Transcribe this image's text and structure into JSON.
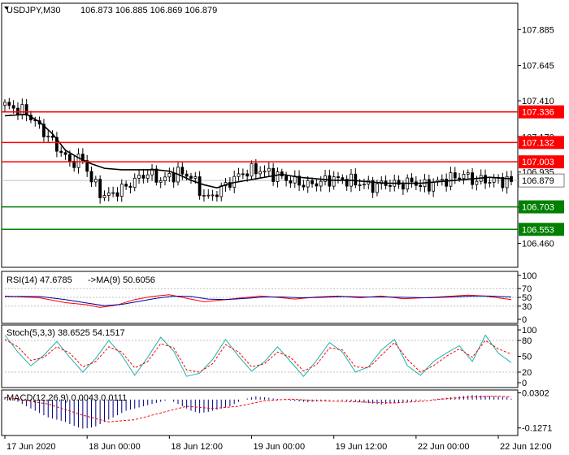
{
  "chart_data": [
    {
      "type": "candlestick",
      "header": {
        "symbol_tf": "USDJPY,M30",
        "ohlc": "106.873 106.885 106.869 106.879"
      },
      "ylim": [
        106.3,
        108.06
      ],
      "y_ticks": [
        "107.885",
        "107.645",
        "107.410",
        "107.170",
        "106.935",
        "106.700",
        "106.460"
      ],
      "last_price": {
        "value": 106.879,
        "label": "106.879"
      },
      "levels": [
        {
          "value": 107.336,
          "label": "107.336",
          "color": "#ff0000",
          "kind": "resistance"
        },
        {
          "value": 107.132,
          "label": "107.132",
          "color": "#ff0000",
          "kind": "resistance"
        },
        {
          "value": 107.003,
          "label": "107.003",
          "color": "#ff0000",
          "kind": "resistance"
        },
        {
          "value": 106.703,
          "label": "106.703",
          "color": "#008000",
          "kind": "support"
        },
        {
          "value": 106.553,
          "label": "106.553",
          "color": "#008000",
          "kind": "support"
        }
      ],
      "moving_average_color": "#000000",
      "close_path": [
        [
          0,
          107.38
        ],
        [
          5,
          107.33
        ],
        [
          10,
          107.17
        ],
        [
          15,
          107.0
        ],
        [
          18,
          107.02
        ],
        [
          20,
          106.88
        ],
        [
          23,
          106.77
        ],
        [
          27,
          106.82
        ],
        [
          30,
          106.88
        ],
        [
          33,
          106.93
        ],
        [
          36,
          106.88
        ],
        [
          40,
          106.93
        ],
        [
          43,
          106.91
        ],
        [
          45,
          106.81
        ],
        [
          47,
          106.76
        ],
        [
          49,
          106.8
        ],
        [
          52,
          106.87
        ],
        [
          55,
          106.93
        ],
        [
          58,
          106.95
        ],
        [
          61,
          106.93
        ],
        [
          64,
          106.9
        ],
        [
          67,
          106.87
        ],
        [
          70,
          106.85
        ],
        [
          73,
          106.87
        ],
        [
          76,
          106.89
        ],
        [
          79,
          106.88
        ],
        [
          82,
          106.86
        ],
        [
          85,
          106.84
        ],
        [
          88,
          106.86
        ],
        [
          91,
          106.85
        ],
        [
          94,
          106.87
        ],
        [
          97,
          106.84
        ],
        [
          100,
          106.87
        ],
        [
          103,
          106.89
        ],
        [
          106,
          106.92
        ],
        [
          108,
          106.88
        ],
        [
          111,
          106.88
        ],
        [
          114,
          106.88
        ],
        [
          117,
          106.87
        ]
      ],
      "ma_path": [
        [
          0,
          107.31
        ],
        [
          5,
          107.32
        ],
        [
          8,
          107.27
        ],
        [
          11,
          107.19
        ],
        [
          14,
          107.08
        ],
        [
          17,
          107.03
        ],
        [
          20,
          106.99
        ],
        [
          23,
          106.96
        ],
        [
          27,
          106.95
        ],
        [
          31,
          106.95
        ],
        [
          35,
          106.95
        ],
        [
          38,
          106.94
        ],
        [
          40,
          106.92
        ],
        [
          43,
          106.88
        ],
        [
          46,
          106.85
        ],
        [
          49,
          106.83
        ],
        [
          52,
          106.86
        ],
        [
          56,
          106.88
        ],
        [
          60,
          106.9
        ],
        [
          64,
          106.92
        ],
        [
          68,
          106.9
        ],
        [
          72,
          106.89
        ],
        [
          76,
          106.88
        ],
        [
          80,
          106.88
        ],
        [
          84,
          106.87
        ],
        [
          88,
          106.86
        ],
        [
          92,
          106.86
        ],
        [
          96,
          106.86
        ],
        [
          100,
          106.87
        ],
        [
          104,
          106.88
        ],
        [
          108,
          106.89
        ],
        [
          112,
          106.9
        ],
        [
          117,
          106.89
        ]
      ],
      "x_ticks": [
        {
          "i": 0,
          "label": "17 Jun 2020"
        },
        {
          "i": 19,
          "label": "18 Jun 00:00"
        },
        {
          "i": 38,
          "label": "18 Jun 12:00"
        },
        {
          "i": 57,
          "label": "19 Jun 00:00"
        },
        {
          "i": 76,
          "label": "19 Jun 12:00"
        },
        {
          "i": 95,
          "label": "22 Jun 00:00"
        },
        {
          "i": 114,
          "label": "22 Jun 12:00"
        }
      ]
    },
    {
      "type": "line",
      "title": "RSI(14) 47.6785",
      "title2": "->MA(9) 50.6056",
      "ylim": [
        0,
        100
      ],
      "y_ticks": [
        "100",
        "70",
        "50",
        "30",
        "0"
      ],
      "levels": [
        70,
        50,
        30
      ],
      "series": [
        {
          "color": "#ff0000",
          "points": [
            [
              0,
              53
            ],
            [
              8,
              49
            ],
            [
              14,
              38
            ],
            [
              19,
              33
            ],
            [
              22,
              27
            ],
            [
              26,
              33
            ],
            [
              30,
              45
            ],
            [
              34,
              52
            ],
            [
              38,
              56
            ],
            [
              42,
              48
            ],
            [
              46,
              40
            ],
            [
              50,
              44
            ],
            [
              55,
              49
            ],
            [
              59,
              53
            ],
            [
              63,
              50
            ],
            [
              67,
              46
            ],
            [
              72,
              51
            ],
            [
              77,
              53
            ],
            [
              82,
              49
            ],
            [
              87,
              53
            ],
            [
              92,
              47
            ],
            [
              97,
              49
            ],
            [
              102,
              52
            ],
            [
              107,
              55
            ],
            [
              111,
              53
            ],
            [
              117,
              45
            ]
          ]
        },
        {
          "color": "#0000a0",
          "points": [
            [
              0,
              52
            ],
            [
              8,
              52
            ],
            [
              14,
              45
            ],
            [
              19,
              37
            ],
            [
              23,
              31
            ],
            [
              27,
              34
            ],
            [
              31,
              41
            ],
            [
              35,
              48
            ],
            [
              39,
              53
            ],
            [
              43,
              52
            ],
            [
              47,
              46
            ],
            [
              51,
              45
            ],
            [
              56,
              48
            ],
            [
              60,
              51
            ],
            [
              64,
              51
            ],
            [
              68,
              49
            ],
            [
              73,
              50
            ],
            [
              78,
              52
            ],
            [
              83,
              51
            ],
            [
              88,
              51
            ],
            [
              93,
              50
            ],
            [
              98,
              49
            ],
            [
              103,
              51
            ],
            [
              108,
              53
            ],
            [
              112,
              53
            ],
            [
              117,
              51
            ]
          ]
        }
      ]
    },
    {
      "type": "line",
      "title": "Stoch(5,3,3) 38.6525 54.1517",
      "ylim": [
        0,
        100
      ],
      "y_ticks": [
        "100",
        "80",
        "50",
        "20",
        "0"
      ],
      "levels": [
        80,
        20
      ],
      "series": [
        {
          "color": "#20b2aa",
          "points": [
            [
              0,
              90
            ],
            [
              3,
              58
            ],
            [
              6,
              32
            ],
            [
              9,
              52
            ],
            [
              12,
              78
            ],
            [
              15,
              48
            ],
            [
              18,
              20
            ],
            [
              21,
              46
            ],
            [
              24,
              80
            ],
            [
              27,
              52
            ],
            [
              30,
              14
            ],
            [
              33,
              48
            ],
            [
              36,
              86
            ],
            [
              39,
              60
            ],
            [
              42,
              12
            ],
            [
              45,
              18
            ],
            [
              48,
              44
            ],
            [
              51,
              82
            ],
            [
              54,
              50
            ],
            [
              57,
              22
            ],
            [
              60,
              40
            ],
            [
              63,
              68
            ],
            [
              66,
              40
            ],
            [
              69,
              12
            ],
            [
              72,
              42
            ],
            [
              75,
              76
            ],
            [
              78,
              58
            ],
            [
              81,
              20
            ],
            [
              84,
              30
            ],
            [
              87,
              62
            ],
            [
              90,
              82
            ],
            [
              93,
              32
            ],
            [
              96,
              14
            ],
            [
              99,
              40
            ],
            [
              102,
              56
            ],
            [
              105,
              70
            ],
            [
              108,
              40
            ],
            [
              111,
              90
            ],
            [
              114,
              56
            ],
            [
              117,
              38
            ]
          ]
        },
        {
          "color": "#ff0000",
          "points": [
            [
              0,
              82
            ],
            [
              3,
              68
            ],
            [
              6,
              42
            ],
            [
              9,
              48
            ],
            [
              12,
              68
            ],
            [
              15,
              56
            ],
            [
              18,
              30
            ],
            [
              21,
              40
            ],
            [
              24,
              68
            ],
            [
              27,
              58
            ],
            [
              30,
              28
            ],
            [
              33,
              40
            ],
            [
              36,
              74
            ],
            [
              39,
              66
            ],
            [
              42,
              24
            ],
            [
              45,
              20
            ],
            [
              48,
              36
            ],
            [
              51,
              72
            ],
            [
              54,
              58
            ],
            [
              57,
              30
            ],
            [
              60,
              36
            ],
            [
              63,
              58
            ],
            [
              66,
              48
            ],
            [
              69,
              22
            ],
            [
              72,
              34
            ],
            [
              75,
              66
            ],
            [
              78,
              62
            ],
            [
              81,
              30
            ],
            [
              84,
              28
            ],
            [
              87,
              52
            ],
            [
              90,
              76
            ],
            [
              93,
              44
            ],
            [
              96,
              20
            ],
            [
              99,
              32
            ],
            [
              102,
              50
            ],
            [
              105,
              64
            ],
            [
              108,
              48
            ],
            [
              111,
              80
            ],
            [
              114,
              64
            ],
            [
              117,
              54
            ]
          ]
        }
      ]
    },
    {
      "type": "bar",
      "title": "MACD(12,26,9) 0.0043 0.0111",
      "ylim": [
        -0.15,
        0.032
      ],
      "y_ticks": [
        "0.0302",
        "-0.1271"
      ],
      "bar_color": "#000080",
      "signal_color": "#ff0000",
      "values": [
        0.01,
        0.005,
        0,
        -0.01,
        -0.02,
        -0.03,
        -0.04,
        -0.05,
        -0.06,
        -0.07,
        -0.08,
        -0.085,
        -0.09,
        -0.095,
        -0.1,
        -0.11,
        -0.118,
        -0.125,
        -0.13,
        -0.128,
        -0.125,
        -0.12,
        -0.11,
        -0.1,
        -0.09,
        -0.08,
        -0.07,
        -0.06,
        -0.05,
        -0.045,
        -0.04,
        -0.035,
        -0.03,
        -0.025,
        -0.02,
        -0.015,
        -0.01,
        -0.005,
        0,
        -0.01,
        -0.02,
        -0.03,
        -0.04,
        -0.05,
        -0.055,
        -0.06,
        -0.058,
        -0.055,
        -0.05,
        -0.045,
        -0.04,
        -0.035,
        -0.03,
        -0.02,
        -0.01,
        0,
        0.005,
        0.01,
        0.015,
        0.012,
        0.01,
        0.008,
        0.005,
        0.003,
        0,
        -0.002,
        -0.004,
        -0.006,
        -0.008,
        -0.01,
        -0.012,
        -0.01,
        -0.008,
        -0.006,
        -0.004,
        -0.002,
        0,
        -0.002,
        -0.004,
        -0.006,
        -0.008,
        -0.01,
        -0.012,
        -0.014,
        -0.016,
        -0.018,
        -0.02,
        -0.022,
        -0.02,
        -0.018,
        -0.016,
        -0.014,
        -0.012,
        -0.01,
        -0.008,
        -0.006,
        -0.004,
        -0.002,
        0,
        0.002,
        0.004,
        0.006,
        0.008,
        0.01,
        0.012,
        0.014,
        0.016,
        0.018,
        0.02,
        0.019,
        0.018,
        0.017,
        0.016,
        0.015,
        0.014,
        0.013,
        0.012,
        0.004
      ],
      "signal": [
        [
          0,
          0.01
        ],
        [
          10,
          -0.02
        ],
        [
          18,
          -0.07
        ],
        [
          24,
          -0.1
        ],
        [
          30,
          -0.09
        ],
        [
          36,
          -0.06
        ],
        [
          42,
          -0.03
        ],
        [
          48,
          -0.04
        ],
        [
          54,
          -0.03
        ],
        [
          60,
          -0.005
        ],
        [
          66,
          0.002
        ],
        [
          72,
          -0.005
        ],
        [
          78,
          -0.008
        ],
        [
          84,
          -0.012
        ],
        [
          90,
          -0.015
        ],
        [
          96,
          -0.008
        ],
        [
          102,
          0.004
        ],
        [
          108,
          0.012
        ],
        [
          114,
          0.016
        ],
        [
          117,
          0.011
        ]
      ]
    }
  ]
}
